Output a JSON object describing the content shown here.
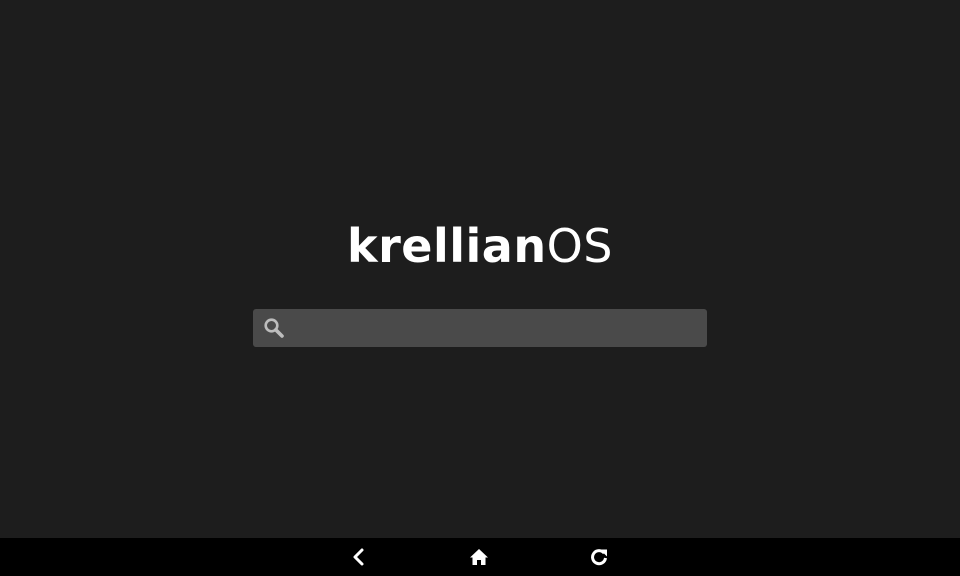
{
  "logo": {
    "bold_part": "krellian",
    "light_part": "OS"
  },
  "search": {
    "value": "",
    "placeholder": "",
    "icon": "search-icon"
  },
  "navbar": {
    "items": [
      {
        "name": "back",
        "icon": "chevron-left-icon"
      },
      {
        "name": "home",
        "icon": "home-icon"
      },
      {
        "name": "reload",
        "icon": "reload-icon"
      }
    ]
  },
  "colors": {
    "background": "#1d1d1d",
    "search_box": "#4a4a4a",
    "navbar": "#000000",
    "icon": "#ffffff",
    "search_icon": "#bdbdbd"
  }
}
